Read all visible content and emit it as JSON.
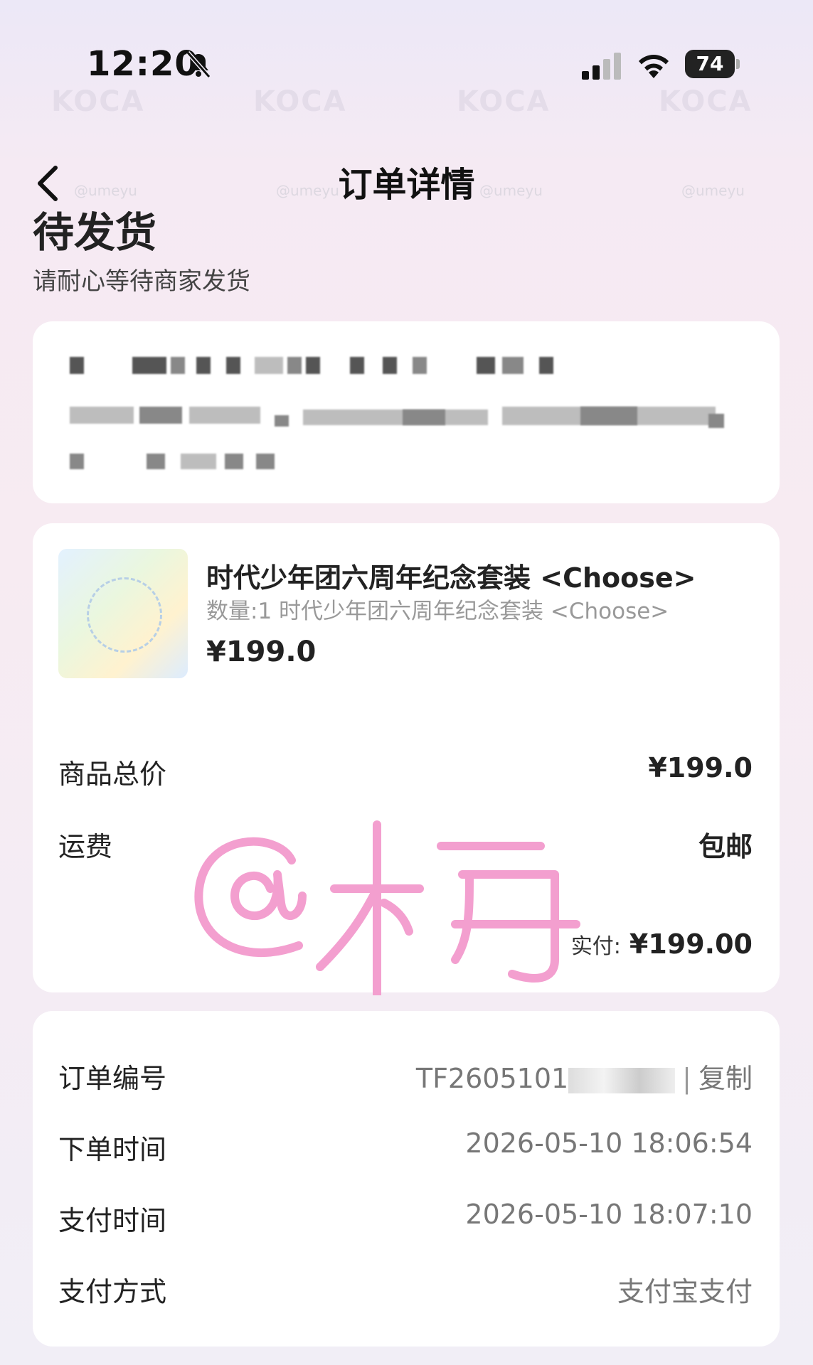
{
  "status_bar": {
    "time": "12:20",
    "battery": "74"
  },
  "nav": {
    "title": "订单详情"
  },
  "order_status": {
    "title": "待发货",
    "subtitle": "请耐心等待商家发货"
  },
  "product": {
    "title": "时代少年团六周年纪念套装 <Choose>",
    "description": "数量:1 时代少年团六周年纪念套装 <Choose>",
    "price": "¥199.0"
  },
  "price_summary": {
    "subtotal_label": "商品总价",
    "subtotal_value": "¥199.0",
    "shipping_label": "运费",
    "shipping_value": "包邮",
    "paid_label": "实付:",
    "paid_value": "¥199.00"
  },
  "order_info": {
    "order_no_label": "订单编号",
    "order_no_prefix": "TF2605101",
    "copy_label": "复制",
    "order_time_label": "下单时间",
    "order_time_value": "2026-05-10 18:06:54",
    "pay_time_label": "支付时间",
    "pay_time_value": "2026-05-10 18:07:10",
    "pay_method_label": "支付方式",
    "pay_method_value": "支付宝支付"
  },
  "watermark": {
    "brand": "KOCA",
    "handle": "@umeyu"
  },
  "colors": {
    "accent_pink": "#f39fcf"
  }
}
